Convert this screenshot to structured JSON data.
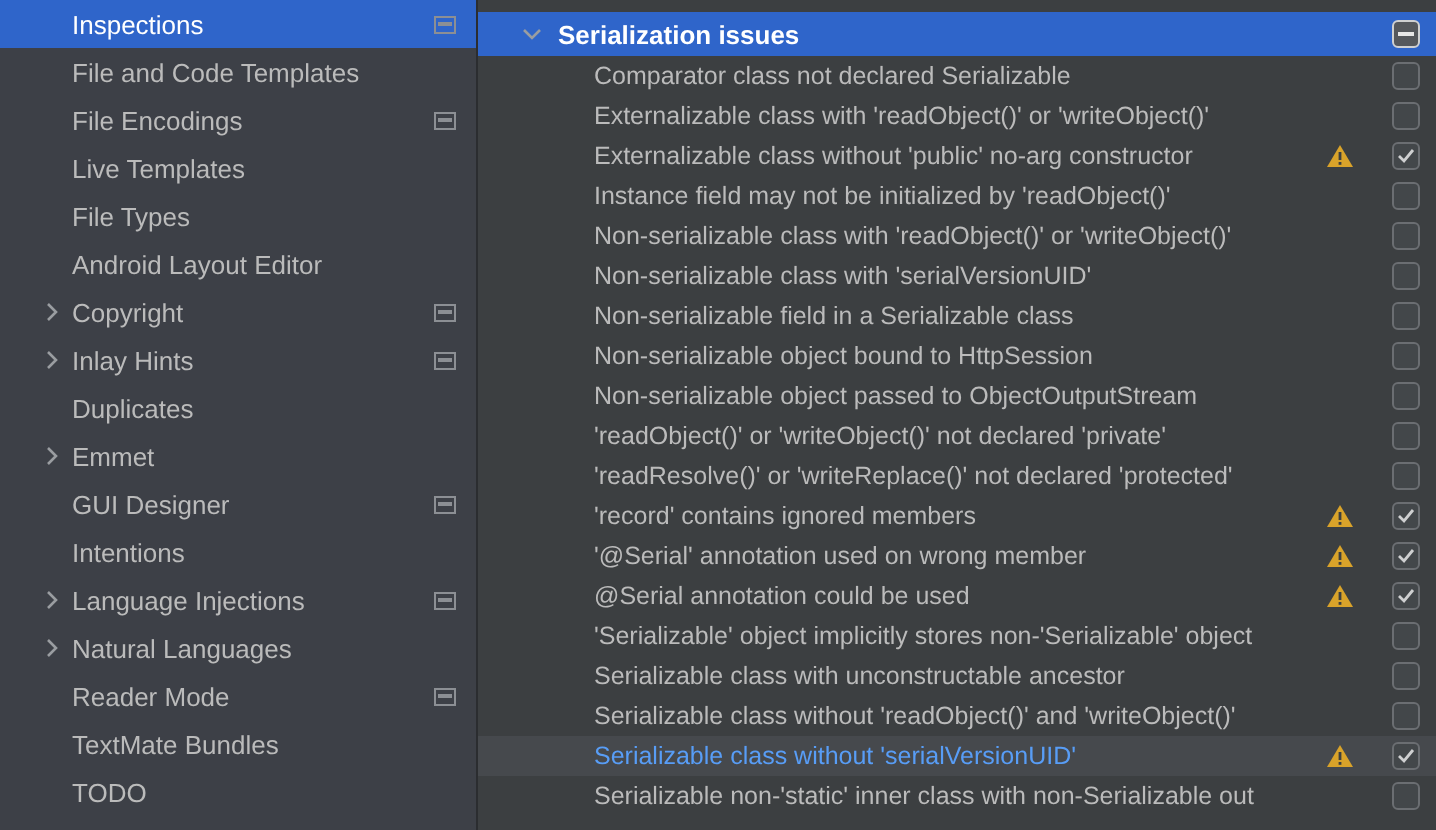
{
  "sidebar": {
    "items": [
      {
        "label": "Inspections",
        "expandable": false,
        "selected": true,
        "project_icon": true
      },
      {
        "label": "File and Code Templates",
        "expandable": false,
        "selected": false,
        "project_icon": false
      },
      {
        "label": "File Encodings",
        "expandable": false,
        "selected": false,
        "project_icon": true
      },
      {
        "label": "Live Templates",
        "expandable": false,
        "selected": false,
        "project_icon": false
      },
      {
        "label": "File Types",
        "expandable": false,
        "selected": false,
        "project_icon": false
      },
      {
        "label": "Android Layout Editor",
        "expandable": false,
        "selected": false,
        "project_icon": false
      },
      {
        "label": "Copyright",
        "expandable": true,
        "selected": false,
        "project_icon": true
      },
      {
        "label": "Inlay Hints",
        "expandable": true,
        "selected": false,
        "project_icon": true
      },
      {
        "label": "Duplicates",
        "expandable": false,
        "selected": false,
        "project_icon": false
      },
      {
        "label": "Emmet",
        "expandable": true,
        "selected": false,
        "project_icon": false
      },
      {
        "label": "GUI Designer",
        "expandable": false,
        "selected": false,
        "project_icon": true
      },
      {
        "label": "Intentions",
        "expandable": false,
        "selected": false,
        "project_icon": false
      },
      {
        "label": "Language Injections",
        "expandable": true,
        "selected": false,
        "project_icon": true
      },
      {
        "label": "Natural Languages",
        "expandable": true,
        "selected": false,
        "project_icon": false
      },
      {
        "label": "Reader Mode",
        "expandable": false,
        "selected": false,
        "project_icon": true
      },
      {
        "label": "TextMate Bundles",
        "expandable": false,
        "selected": false,
        "project_icon": false
      },
      {
        "label": "TODO",
        "expandable": false,
        "selected": false,
        "project_icon": false
      }
    ]
  },
  "inspections": {
    "group": {
      "label": "Serialization issues",
      "expanded": true,
      "selected": true,
      "mixed": true
    },
    "items": [
      {
        "label": "Comparator class not declared Serializable",
        "warning": false,
        "checked": false,
        "selected": false
      },
      {
        "label": "Externalizable class with 'readObject()' or 'writeObject()'",
        "warning": false,
        "checked": false,
        "selected": false
      },
      {
        "label": "Externalizable class without 'public' no-arg constructor",
        "warning": true,
        "checked": true,
        "selected": false
      },
      {
        "label": "Instance field may not be initialized by 'readObject()'",
        "warning": false,
        "checked": false,
        "selected": false
      },
      {
        "label": "Non-serializable class with 'readObject()' or 'writeObject()'",
        "warning": false,
        "checked": false,
        "selected": false
      },
      {
        "label": "Non-serializable class with 'serialVersionUID'",
        "warning": false,
        "checked": false,
        "selected": false
      },
      {
        "label": "Non-serializable field in a Serializable class",
        "warning": false,
        "checked": false,
        "selected": false
      },
      {
        "label": "Non-serializable object bound to HttpSession",
        "warning": false,
        "checked": false,
        "selected": false
      },
      {
        "label": "Non-serializable object passed to ObjectOutputStream",
        "warning": false,
        "checked": false,
        "selected": false
      },
      {
        "label": "'readObject()' or 'writeObject()' not declared 'private'",
        "warning": false,
        "checked": false,
        "selected": false
      },
      {
        "label": "'readResolve()' or 'writeReplace()' not declared 'protected'",
        "warning": false,
        "checked": false,
        "selected": false
      },
      {
        "label": "'record' contains ignored members",
        "warning": true,
        "checked": true,
        "selected": false
      },
      {
        "label": "'@Serial' annotation used on wrong member",
        "warning": true,
        "checked": true,
        "selected": false
      },
      {
        "label": "@Serial annotation could be used",
        "warning": true,
        "checked": true,
        "selected": false
      },
      {
        "label": "'Serializable' object implicitly stores non-'Serializable' object",
        "warning": false,
        "checked": false,
        "selected": false
      },
      {
        "label": "Serializable class with unconstructable ancestor",
        "warning": false,
        "checked": false,
        "selected": false
      },
      {
        "label": "Serializable class without 'readObject()' and 'writeObject()'",
        "warning": false,
        "checked": false,
        "selected": false
      },
      {
        "label": "Serializable class without 'serialVersionUID'",
        "warning": true,
        "checked": true,
        "selected": true
      },
      {
        "label": "Serializable non-'static' inner class with non-Serializable out",
        "warning": false,
        "checked": false,
        "selected": false
      }
    ]
  }
}
